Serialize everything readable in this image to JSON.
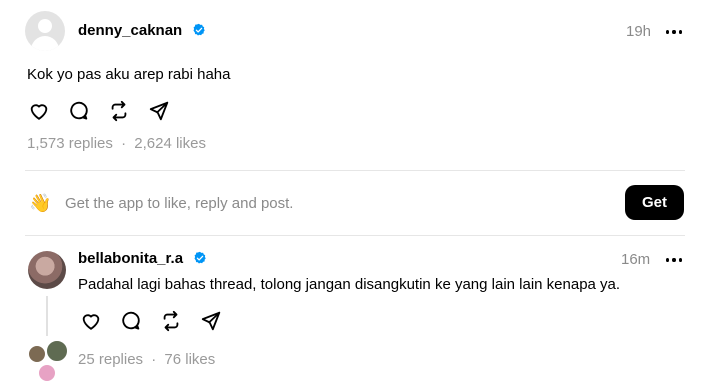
{
  "post": {
    "username": "denny_caknan",
    "time": "19h",
    "text": "Kok yo pas aku arep rabi haha",
    "replies": "1,573 replies",
    "separator": "·",
    "likes": "2,624 likes"
  },
  "cta": {
    "emoji": "👋",
    "text": "Get the app to like, reply and post.",
    "button_label": "Get"
  },
  "reply": {
    "username": "bellabonita_r.a",
    "time": "16m",
    "text": "Padahal lagi bahas thread, tolong jangan disangkutin ke yang lain lain kenapa ya.",
    "replies": "25 replies",
    "separator": "·",
    "likes": "76 likes"
  },
  "colors": {
    "verified": "#0095f6",
    "muted": "#8a8a8a",
    "button_bg": "#000000"
  },
  "icons": [
    "heart-icon",
    "comment-icon",
    "repost-icon",
    "share-icon",
    "more-icon",
    "verified-badge-icon"
  ]
}
